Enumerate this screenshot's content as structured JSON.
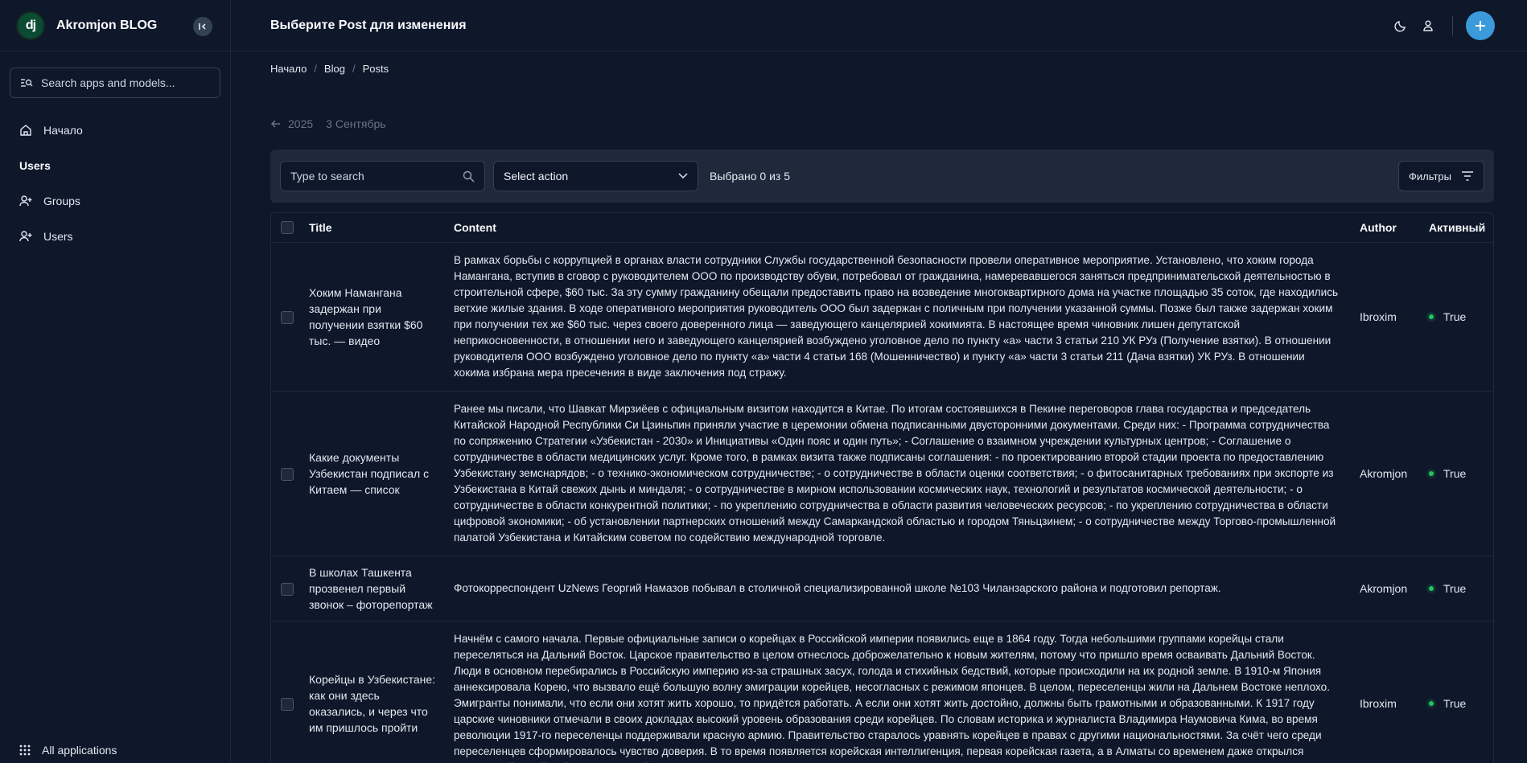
{
  "sidebar": {
    "logo_text": "dj",
    "site_name": "Akromjon BLOG",
    "search_placeholder": "Search apps and models...",
    "home_label": "Начало",
    "section_label": "Users",
    "items": [
      {
        "label": "Groups",
        "icon": "user-plus-icon"
      },
      {
        "label": "Users",
        "icon": "user-plus-icon"
      }
    ],
    "footer_label": "All applications"
  },
  "header": {
    "title": "Выберите Post для изменения",
    "accent_color": "#3b9ad9"
  },
  "breadcrumb": [
    "Начало",
    "Blog",
    "Posts"
  ],
  "date_nav": {
    "year": "2025",
    "day": "3 Сентябрь"
  },
  "toolbar": {
    "search_placeholder": "Type to search",
    "action_label": "Select action",
    "selected_text": "Выбрано 0 из 5",
    "filter_label": "Фильтры"
  },
  "table": {
    "columns": {
      "title": "Title",
      "content": "Content",
      "author": "Author",
      "active": "Активный"
    },
    "rows": [
      {
        "title": "Хоким Намангана задержан при получении взятки $60 тыс. — видео",
        "content": "В рамках борьбы с коррупцией в органах власти сотрудники Службы государственной безопасности провели оперативное мероприятие. Установлено, что хоким города Намангана, вступив в сговор с руководителем ООО по производству обуви, потребовал от гражданина, намеревавшегося заняться предпринимательской деятельностью в строительной сфере, $60 тыс. За эту сумму гражданину обещали предоставить право на возведение многоквартирного дома на участке площадью 35 соток, где находились ветхие жилые здания. В ходе оперативного мероприятия руководитель ООО был задержан с поличным при получении указанной суммы. Позже был также задержан хоким при получении тех же $60 тыс. через своего доверенного лица — заведующего канцелярией хокимията. В настоящее время чиновник лишен депутатской неприкосновенности, в отношении него и заведующего канцелярией возбуждено уголовное дело по пункту «а» части 3 статьи 210 УК РУз (Получение взятки). В отношении руководителя ООО возбуждено уголовное дело по пункту «а» части 4 статьи 168 (Мошенничество) и пункту «а» части 3 статьи 211 (Дача взятки) УК РУз. В отношении хокима избрана мера пресечения в виде заключения под стражу.",
        "author": "Ibroxim",
        "active": "True"
      },
      {
        "title": "Какие документы Узбекистан подписал с Китаем — список",
        "content": "Ранее мы писали, что Шавкат Мирзиёев с официальным визитом находится в Китае. По итогам состоявшихся в Пекине переговоров глава государства и председатель Китайской Народной Республики Си Цзиньпин приняли участие в церемонии обмена подписанными двусторонними документами. Среди них: - Программа сотрудничества по сопряжению Стратегии «Узбекистан - 2030» и Инициативы «Один пояс и один путь»; - Соглашение о взаимном учреждении культурных центров; - Соглашение о сотрудничестве в области медицинских услуг. Кроме того, в рамках визита также подписаны соглашения: - по проектированию второй стадии проекта по предоставлению Узбекистану земснарядов; - о технико-экономическом сотрудничестве; - о сотрудничестве в области оценки соответствия; - о фитосанитарных требованиях при экспорте из Узбекистана в Китай свежих дынь и миндаля; - о сотрудничестве в мирном использовании космических наук, технологий и результатов космической деятельности; - о сотрудничестве в области конкурентной политики; - по укреплению сотрудничества в области развития человеческих ресурсов; - по укреплению сотрудничества в области цифровой экономики; - об установлении партнерских отношений между Самаркандской областью и городом Тяньцзинем; - о сотрудничестве между Торгово-промышленной палатой Узбекистана и Китайским советом по содействию международной торговле.",
        "author": "Akromjon",
        "active": "True"
      },
      {
        "title": "В школах Ташкента прозвенел первый звонок – фоторепортаж",
        "content": "Фотокорреспондент UzNews Георгий Намазов побывал в столичной специализированной школе №103 Чиланзарского района и подготовил репортаж.",
        "author": "Akromjon",
        "active": "True"
      },
      {
        "title": "Корейцы в Узбекистане: как они здесь оказались, и через что им пришлось пройти",
        "content": "Начнём с самого начала. Первые официальные записи о корейцах в Российской империи появились еще в 1864 году. Тогда небольшими группами корейцы стали переселяться на Дальний Восток. Царское правительство в целом отнеслось доброжелательно к новым жителям, потому что пришло время осваивать Дальний Восток. Люди в основном перебирались в Российскую империю из-за страшных засух, голода и стихийных бедствий, которые происходили на их родной земле. В 1910-м Япония аннексировала Корею, что вызвало ещё большую волну эмиграции корейцев, несогласных с режимом японцев. В целом, переселенцы жили на Дальнем Востоке неплохо. Эмигранты понимали, что если они хотят жить хорошо, то придётся работать. А если они хотят жить достойно, должны быть грамотными и образованными. К 1917 году царские чиновники отмечали в своих докладах высокий уровень образования среди корейцев. По словам историка и журналиста Владимира Наумовича Кима, во время революции 1917-го переселенцы поддерживали красную армию. Правительство старалось уравнять корейцев в правах с другими национальностями. За счёт чего среди переселенцев сформировалось чувство доверия. В то время появляется корейская интеллигенция, первая корейская газета, а в Алматы со временем даже открылся уникальный корейский театр, который скоро отметит своё столетие.",
        "author": "Ibroxim",
        "active": "True"
      }
    ]
  }
}
